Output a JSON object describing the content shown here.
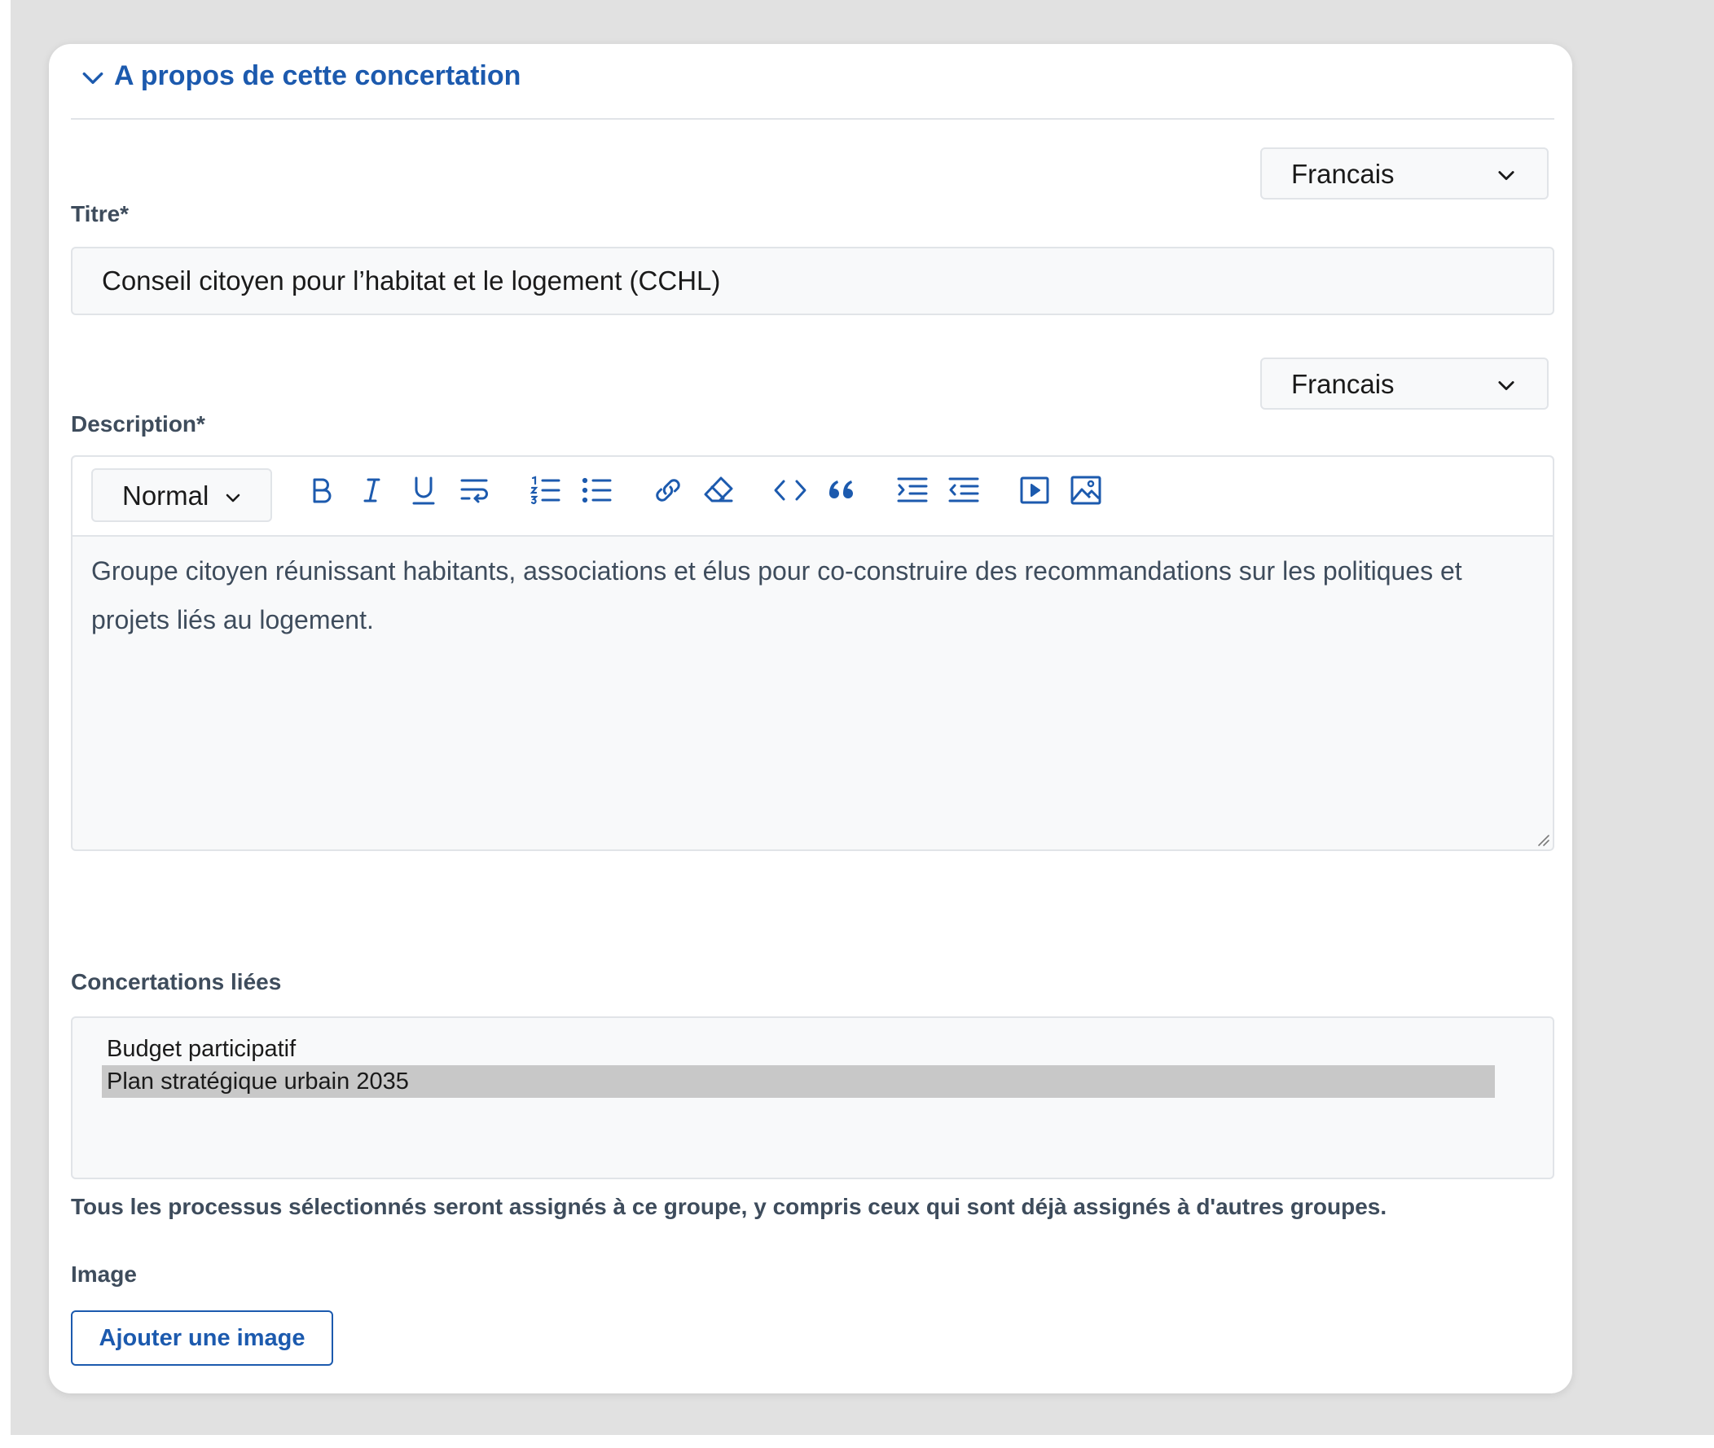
{
  "section": {
    "title": "A propos de cette concertation"
  },
  "title_field": {
    "language": "Francais",
    "label": "Titre*",
    "value": "Conseil citoyen pour l’habitat et le logement (CCHL)"
  },
  "description_field": {
    "language": "Francais",
    "label": "Description*",
    "format": "Normal",
    "content": "Groupe citoyen réunissant habitants, associations et élus pour co-construire des recommandations sur les politiques et projets liés au logement."
  },
  "linked": {
    "label": "Concertations liées",
    "items": [
      {
        "label": "Budget participatif",
        "selected": false
      },
      {
        "label": "Plan stratégique urbain 2035",
        "selected": true
      }
    ],
    "help": "Tous les processus sélectionnés seront assignés à ce groupe, y compris ceux qui sont déjà assignés à d'autres groupes."
  },
  "image_field": {
    "label": "Image",
    "button": "Ajouter une image"
  },
  "colors": {
    "accent": "#1c5aae",
    "label": "#3e4c5c",
    "border": "#e1e4e8",
    "selected_row": "#c8c8c8"
  },
  "icons": {
    "section_toggle": "chevron-down-icon",
    "toolbar": [
      "bold-icon",
      "italic-icon",
      "underline-icon",
      "wrap-text-icon",
      "ordered-list-icon",
      "bullet-list-icon",
      "link-icon",
      "eraser-icon",
      "code-icon",
      "quote-icon",
      "indent-icon",
      "outdent-icon",
      "video-icon",
      "image-icon"
    ]
  }
}
